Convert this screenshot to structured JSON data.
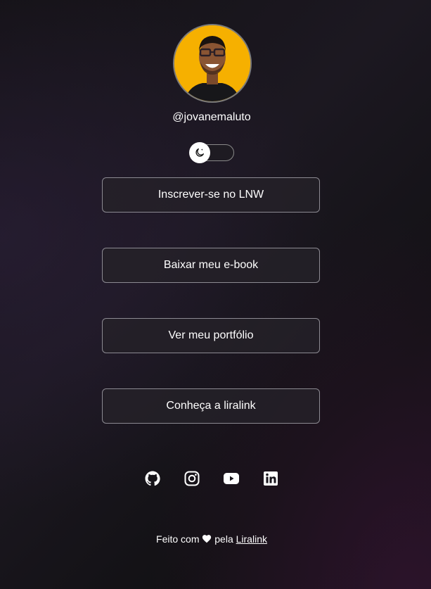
{
  "profile": {
    "username": "@jovanemaluto",
    "avatar_background": "#f6b000"
  },
  "theme_toggle": {
    "icon": "moon-icon",
    "state": "dark"
  },
  "links": [
    {
      "label": "Inscrever-se no LNW"
    },
    {
      "label": "Baixar meu e-book"
    },
    {
      "label": "Ver meu portfólio"
    },
    {
      "label": "Conheça a liralink"
    }
  ],
  "social": [
    {
      "icon": "github-icon"
    },
    {
      "icon": "instagram-icon"
    },
    {
      "icon": "youtube-icon"
    },
    {
      "icon": "linkedin-icon"
    }
  ],
  "footer": {
    "prefix": "Feito com",
    "middle": "pela",
    "link_label": "Liralink"
  },
  "colors": {
    "text": "#ffffff",
    "button_border": "#8c8a92",
    "background": "#18151c"
  }
}
